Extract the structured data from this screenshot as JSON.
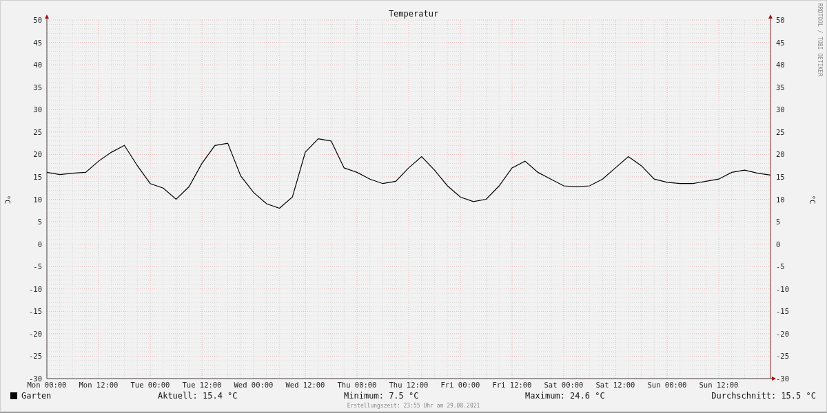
{
  "chart_data": {
    "type": "line",
    "title": "Temperatur",
    "ylabel": "°C",
    "y2label": "°C",
    "categories": [
      "Mon 00:00",
      null,
      null,
      null,
      "Mon 12:00",
      null,
      null,
      null,
      "Tue 00:00",
      null,
      null,
      null,
      "Tue 12:00",
      null,
      null,
      null,
      "Wed 00:00",
      null,
      null,
      null,
      "Wed 12:00",
      null,
      null,
      null,
      "Thu 00:00",
      null,
      null,
      null,
      "Thu 12:00",
      null,
      null,
      null,
      "Fri 00:00",
      null,
      null,
      null,
      "Fri 12:00",
      null,
      null,
      null,
      "Sat 00:00",
      null,
      null,
      null,
      "Sat 12:00",
      null,
      null,
      null,
      "Sun 00:00",
      null,
      null,
      null,
      "Sun 12:00",
      null,
      null,
      null,
      null
    ],
    "series": [
      {
        "name": "Garten",
        "color": "#000000",
        "values": [
          16,
          15.5,
          15.8,
          16,
          18.5,
          20.5,
          22,
          17.5,
          13.5,
          12.5,
          10,
          12.8,
          18,
          22,
          22.5,
          15.2,
          11.5,
          9,
          8,
          10.5,
          20.5,
          23.5,
          23,
          17,
          16,
          14.5,
          13.5,
          14,
          17,
          19.5,
          16.5,
          13,
          10.5,
          9.5,
          10,
          13,
          17,
          18.5,
          16,
          14.5,
          13,
          12.8,
          13,
          14.5,
          17,
          19.5,
          17.5,
          14.5,
          13.8,
          13.5,
          13.5,
          14,
          14.5,
          16,
          16.5,
          15.8,
          15.4
        ]
      }
    ],
    "ylim": [
      -30,
      50
    ],
    "y2lim": [
      -30,
      50
    ],
    "grid": true,
    "yticks": [
      50,
      45,
      40,
      35,
      30,
      25,
      20,
      15,
      10,
      5,
      0,
      -5,
      -10,
      -15,
      -20,
      -25,
      -30
    ],
    "y2ticks": [
      50,
      45,
      40,
      35,
      30,
      25,
      20,
      15,
      10,
      5,
      0,
      -5,
      -10,
      -15,
      -20,
      -25,
      -30
    ]
  },
  "legend": {
    "stats": [
      "Aktuell: 15.4 °C",
      "Minimum: 7.5 °C",
      "Maximum: 24.6 °C",
      "Durchschnitt: 15.5 °C"
    ]
  },
  "credit": "RRDTOOL / TOBI OETIKER",
  "footer": "Erstellungszeit: 23:55 Uhr am 29.08.2021"
}
